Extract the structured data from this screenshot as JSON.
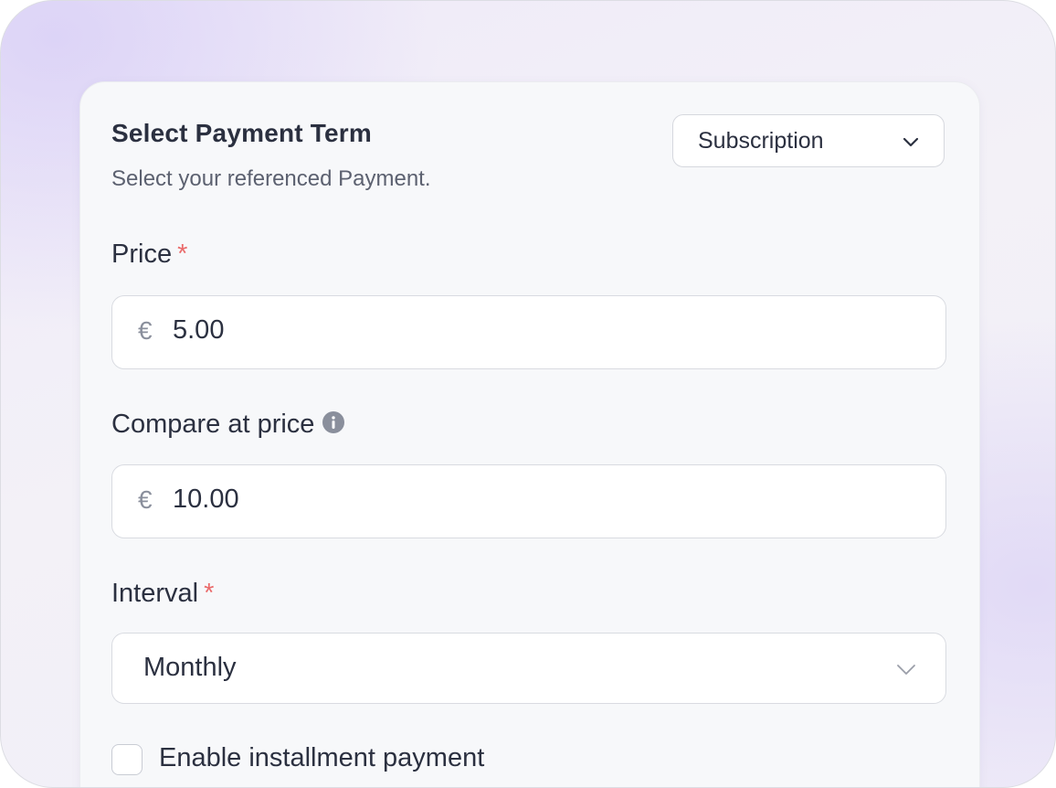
{
  "form": {
    "payment_term": {
      "title": "Select Payment Term",
      "subtitle": "Select your referenced Payment.",
      "selected": "Subscription",
      "dropdown_icon": "chevron-down-icon"
    },
    "price": {
      "label": "Price",
      "required_mark": "*",
      "currency_symbol": "€",
      "value": "5.00"
    },
    "compare_at_price": {
      "label": "Compare at price",
      "info_icon": "info-icon",
      "currency_symbol": "€",
      "value": "10.00"
    },
    "interval": {
      "label": "Interval",
      "required_mark": "*",
      "selected": "Monthly",
      "dropdown_icon": "chevron-down-icon"
    },
    "installment": {
      "label": "Enable installment payment",
      "checked": false
    }
  },
  "colors": {
    "text_primary": "#2b3040",
    "text_secondary": "#5c6170",
    "required": "#ea6a6a",
    "icon_gray": "#8a8f9c",
    "border": "#d9dbe1",
    "card_bg": "#f7f8fa"
  }
}
